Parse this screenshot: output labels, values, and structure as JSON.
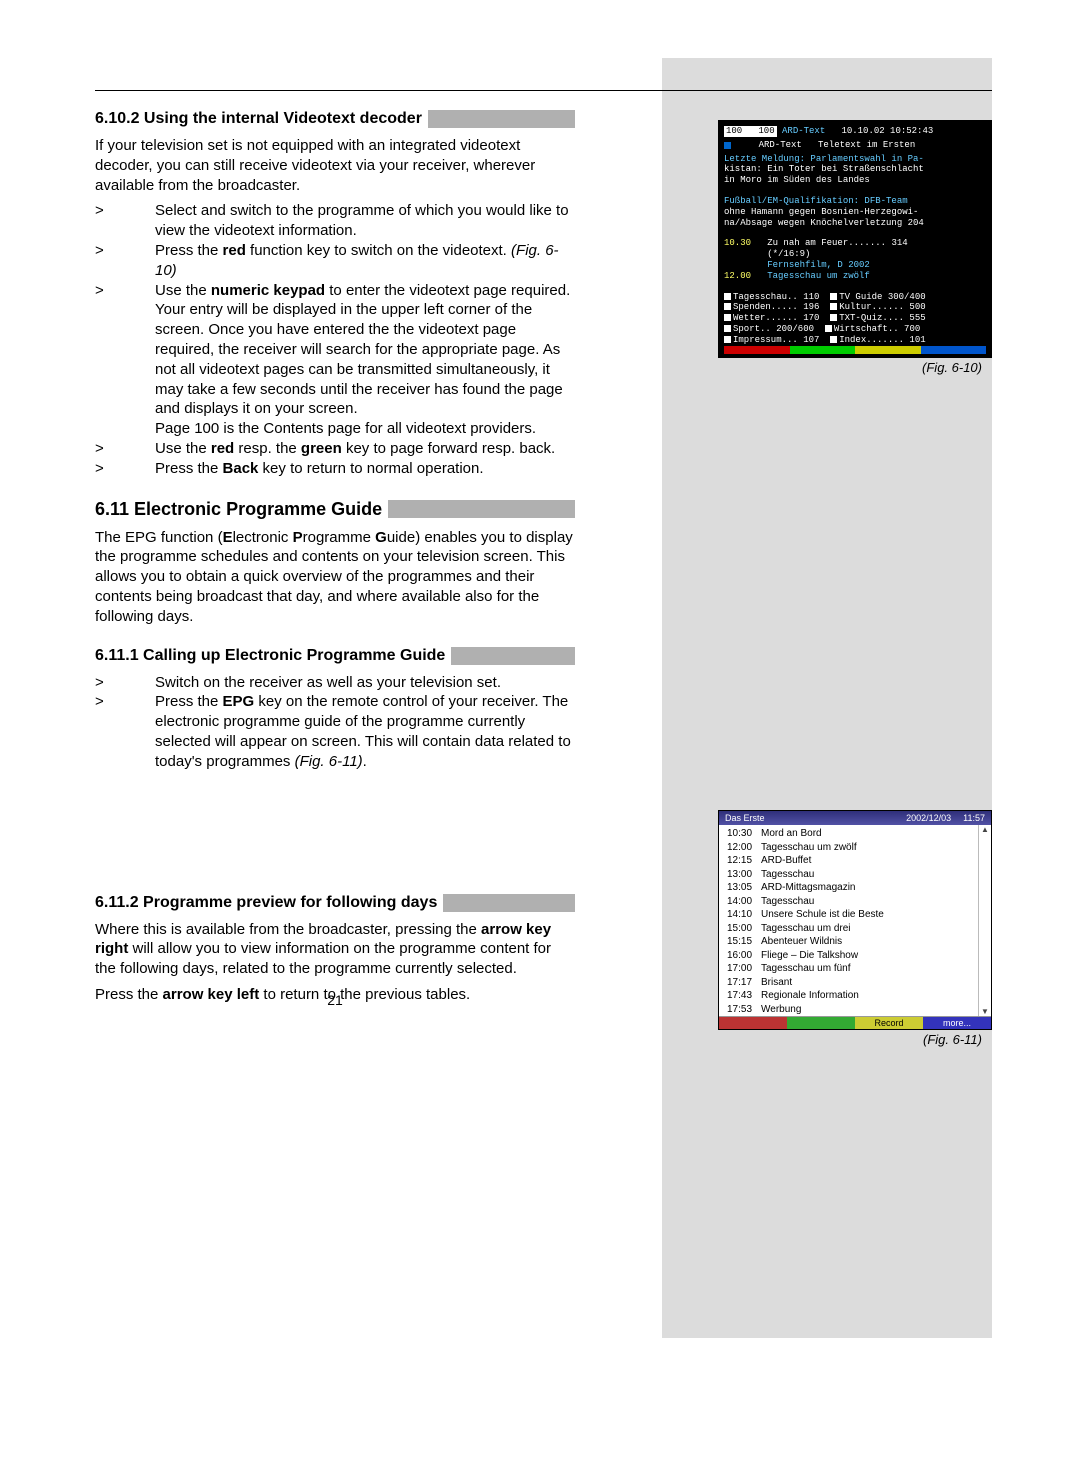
{
  "page_number": "21",
  "sections": {
    "s1": {
      "heading": "6.10.2 Using the internal Videotext decoder",
      "intro": "If your television set is not equipped with an integrated videotext decoder, you can still receive videotext via your receiver, wherever available from the broadcaster.",
      "items": [
        {
          "marker": ">",
          "pre": "Select and switch to the programme of which you would like to view the videotext information."
        },
        {
          "marker": ">",
          "pre": "Press the ",
          "bold": "red",
          "post": " function key to switch on the videotext. ",
          "figref": "(Fig. 6-10)"
        },
        {
          "marker": ">",
          "pre": "Use the ",
          "bold": "numeric keypad",
          "post": " to enter the videotext page required. Your entry will be displayed in the upper left corner of the screen. Once you have entered the the videotext page required, the receiver will search for the appropriate page. As not all videotext pages can be transmitted simultaneously, it may take a few seconds until the receiver has found the page and displays it on your screen.",
          "extra": "Page 100 is the Contents page for all videotext providers."
        },
        {
          "marker": ">",
          "pre": "Use the ",
          "bold": "red",
          "mid": " resp. the ",
          "bold2": "green",
          "post": " key to page forward resp. back."
        },
        {
          "marker": ">",
          "pre": "Press the ",
          "bold": "Back",
          "post": " key to return to normal operation."
        }
      ]
    },
    "s2": {
      "heading": "6.11 Electronic Programme Guide",
      "intro_pre": "The EPG function (",
      "b1": "E",
      "t1": "lectronic ",
      "b2": "P",
      "t2": "rogramme ",
      "b3": "G",
      "t3": "uide) enables you to display the programme schedules and contents on your television screen. This allows you to obtain a quick overview of the programmes and their contents being broadcast that day, and where available also for the following days."
    },
    "s3": {
      "heading": "6.11.1 Calling up Electronic Programme Guide",
      "items": [
        {
          "marker": ">",
          "pre": "Switch on the receiver as well as your television set."
        },
        {
          "marker": ">",
          "pre": "Press the ",
          "bold": "EPG",
          "post": " key on the remote control of your receiver. The electronic programme guide of the programme currently selected will appear on screen. This will contain data related to today's programmes ",
          "figref": "(Fig. 6-11)",
          "figref_post": "."
        }
      ]
    },
    "s4": {
      "heading": "6.11.2 Programme preview for following days",
      "p1_pre": "Where this is available from the broadcaster, pressing the ",
      "p1_bold": "arrow key right",
      "p1_post": " will allow you to view information on the programme content for the following days, related to the programme currently selected.",
      "p2_pre": "Press the ",
      "p2_bold": "arrow key left",
      "p2_post": " to return to the previous tables."
    }
  },
  "fig610": {
    "caption": "(Fig. 6-10)",
    "topbar_left": "100   100",
    "topbar_mid": "ARD-Text",
    "topbar_right": "10.10.02 10:52:43",
    "line1": "    ARD-Text   Teletext im Ersten",
    "block1a": "Letzte Meldung: Parlamentswahl in Pa-",
    "block1b": "kistan: Ein Toter bei Straßenschlacht",
    "block1c": "in Moro im Süden des Landes",
    "block2a": "Fußball/EM-Qualifikation: DFB-Team",
    "block2b": "ohne Hamann gegen Bosnien-Herzegowi-",
    "block2c": "na/Absage wegen Knöchelverletzung 204",
    "time1": "10.30",
    "prog1a": "Zu nah am Feuer....... 314",
    "prog1b": "(*/16:9)",
    "prog1c": "Fernsehfilm, D 2002",
    "time2": "12.00",
    "prog2": "Tagesschau um zwölf",
    "menu": [
      {
        "l": "Tagesschau.. 110",
        "r": "TV Guide 300/400"
      },
      {
        "l": "Spenden..... 196",
        "r": "Kultur...... 500"
      },
      {
        "l": "Wetter...... 170",
        "r": "TXT-Quiz.... 555"
      },
      {
        "l": "Sport.. 200/600",
        "r": "Wirtschaft.. 700"
      },
      {
        "l": "Impressum... 107",
        "r": "Index....... 101"
      }
    ]
  },
  "fig611": {
    "caption": "(Fig. 6-11)",
    "header_channel": "Das Erste",
    "header_date": "2002/12/03",
    "header_time": "11:57",
    "rows": [
      {
        "t": "10:30",
        "p": "Mord an Bord"
      },
      {
        "t": "12:00",
        "p": "Tagesschau um zwölf"
      },
      {
        "t": "12:15",
        "p": "ARD-Buffet"
      },
      {
        "t": "13:00",
        "p": "Tagesschau"
      },
      {
        "t": "13:05",
        "p": "ARD-Mittagsmagazin"
      },
      {
        "t": "14:00",
        "p": "Tagesschau"
      },
      {
        "t": "14:10",
        "p": "Unsere Schule ist die Beste"
      },
      {
        "t": "15:00",
        "p": "Tagesschau um drei"
      },
      {
        "t": "15:15",
        "p": "Abenteuer Wildnis"
      },
      {
        "t": "16:00",
        "p": "Fliege – Die Talkshow"
      },
      {
        "t": "17:00",
        "p": "Tagesschau um fünf"
      },
      {
        "t": "17:17",
        "p": "Brisant"
      },
      {
        "t": "17:43",
        "p": "Regionale Information"
      },
      {
        "t": "17:53",
        "p": "Werbung"
      }
    ],
    "footer": {
      "rec": "Record",
      "more": "more..."
    }
  }
}
